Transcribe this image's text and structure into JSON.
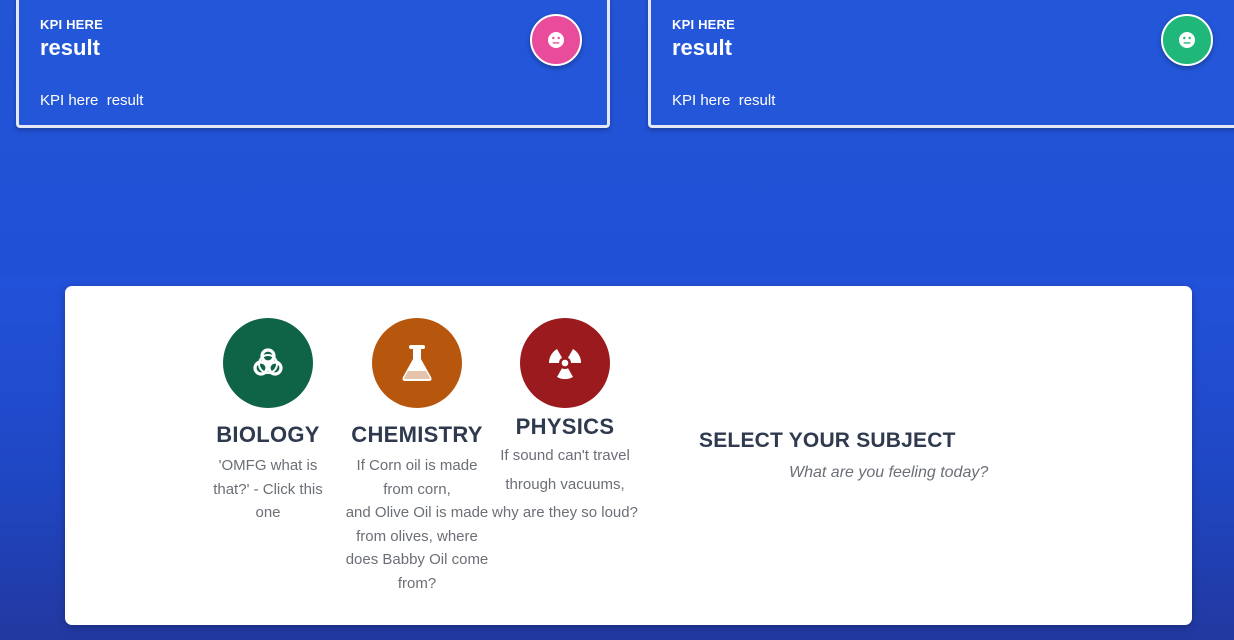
{
  "kpis": [
    {
      "label": "KPI HERE",
      "value": "result",
      "sub": "KPI here  result",
      "icon": "neutral-face-icon",
      "color": "#ea4c9c"
    },
    {
      "label": "KPI HERE",
      "value": "result",
      "sub": "KPI here  result",
      "icon": "neutral-face-icon",
      "color": "#1fb87a"
    }
  ],
  "subjects": [
    {
      "title": "BIOLOGY",
      "description": "'OMFG what is that?' - Click this one",
      "icon": "biohazard-icon",
      "color": "#0f6346"
    },
    {
      "title": "CHEMISTRY",
      "description": "If Corn oil is made from corn,\nand Olive Oil is made from olives, where does Babby Oil come from?",
      "icon": "flask-icon",
      "color": "#b7560d"
    },
    {
      "title": "PHYSICS",
      "description": "If sound can't travel through vacuums, why are they so loud?",
      "icon": "radiation-icon",
      "color": "#9b1a1e"
    }
  ],
  "select": {
    "title": "SELECT YOUR SUBJECT",
    "subtitle": "What are you feeling today?"
  }
}
